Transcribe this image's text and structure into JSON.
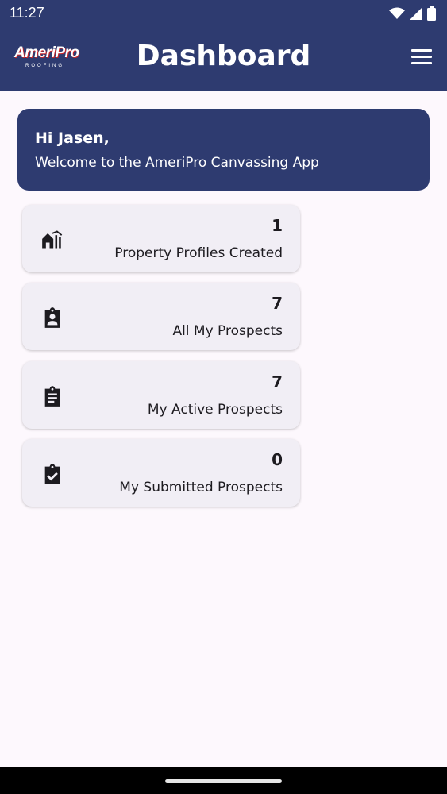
{
  "status_bar": {
    "time": "11:27",
    "icons": [
      "wifi-icon",
      "cellular-signal-icon",
      "battery-icon"
    ]
  },
  "app_bar": {
    "logo_text": "AmeriPro",
    "logo_subtext": "ROOFING",
    "title": "Dashboard",
    "menu_icon": "hamburger-menu-icon"
  },
  "welcome": {
    "greeting": "Hi Jasen,",
    "message": "Welcome to the AmeriPro Canvassing App"
  },
  "stats": [
    {
      "count": "1",
      "label": "Property Profiles Created",
      "icon": "houses-icon"
    },
    {
      "count": "7",
      "label": "All My Prospects",
      "icon": "clipboard-account-icon"
    },
    {
      "count": "7",
      "label": "My Active Prospects",
      "icon": "clipboard-text-icon"
    },
    {
      "count": "0",
      "label": "My Submitted Prospects",
      "icon": "clipboard-check-icon"
    }
  ],
  "colors": {
    "primary": "#2e3b70",
    "background": "#fdf8fd",
    "card": "#f1eef5",
    "text": "#1d1b20",
    "logo_accent": "#c9262b"
  }
}
